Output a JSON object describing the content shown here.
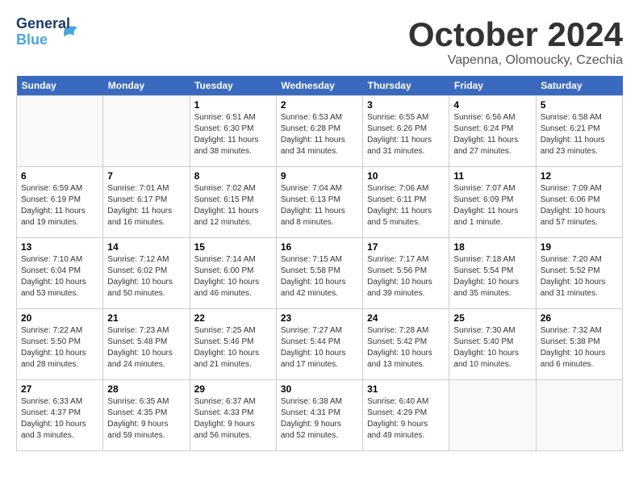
{
  "header": {
    "logo_line1": "General",
    "logo_line2": "Blue",
    "month": "October 2024",
    "location": "Vapenna, Olomoucky, Czechia"
  },
  "days_of_week": [
    "Sunday",
    "Monday",
    "Tuesday",
    "Wednesday",
    "Thursday",
    "Friday",
    "Saturday"
  ],
  "weeks": [
    [
      {
        "day": "",
        "info": ""
      },
      {
        "day": "",
        "info": ""
      },
      {
        "day": "1",
        "info": "Sunrise: 6:51 AM\nSunset: 6:30 PM\nDaylight: 11 hours\nand 38 minutes."
      },
      {
        "day": "2",
        "info": "Sunrise: 6:53 AM\nSunset: 6:28 PM\nDaylight: 11 hours\nand 34 minutes."
      },
      {
        "day": "3",
        "info": "Sunrise: 6:55 AM\nSunset: 6:26 PM\nDaylight: 11 hours\nand 31 minutes."
      },
      {
        "day": "4",
        "info": "Sunrise: 6:56 AM\nSunset: 6:24 PM\nDaylight: 11 hours\nand 27 minutes."
      },
      {
        "day": "5",
        "info": "Sunrise: 6:58 AM\nSunset: 6:21 PM\nDaylight: 11 hours\nand 23 minutes."
      }
    ],
    [
      {
        "day": "6",
        "info": "Sunrise: 6:59 AM\nSunset: 6:19 PM\nDaylight: 11 hours\nand 19 minutes."
      },
      {
        "day": "7",
        "info": "Sunrise: 7:01 AM\nSunset: 6:17 PM\nDaylight: 11 hours\nand 16 minutes."
      },
      {
        "day": "8",
        "info": "Sunrise: 7:02 AM\nSunset: 6:15 PM\nDaylight: 11 hours\nand 12 minutes."
      },
      {
        "day": "9",
        "info": "Sunrise: 7:04 AM\nSunset: 6:13 PM\nDaylight: 11 hours\nand 8 minutes."
      },
      {
        "day": "10",
        "info": "Sunrise: 7:06 AM\nSunset: 6:11 PM\nDaylight: 11 hours\nand 5 minutes."
      },
      {
        "day": "11",
        "info": "Sunrise: 7:07 AM\nSunset: 6:09 PM\nDaylight: 11 hours\nand 1 minute."
      },
      {
        "day": "12",
        "info": "Sunrise: 7:09 AM\nSunset: 6:06 PM\nDaylight: 10 hours\nand 57 minutes."
      }
    ],
    [
      {
        "day": "13",
        "info": "Sunrise: 7:10 AM\nSunset: 6:04 PM\nDaylight: 10 hours\nand 53 minutes."
      },
      {
        "day": "14",
        "info": "Sunrise: 7:12 AM\nSunset: 6:02 PM\nDaylight: 10 hours\nand 50 minutes."
      },
      {
        "day": "15",
        "info": "Sunrise: 7:14 AM\nSunset: 6:00 PM\nDaylight: 10 hours\nand 46 minutes."
      },
      {
        "day": "16",
        "info": "Sunrise: 7:15 AM\nSunset: 5:58 PM\nDaylight: 10 hours\nand 42 minutes."
      },
      {
        "day": "17",
        "info": "Sunrise: 7:17 AM\nSunset: 5:56 PM\nDaylight: 10 hours\nand 39 minutes."
      },
      {
        "day": "18",
        "info": "Sunrise: 7:18 AM\nSunset: 5:54 PM\nDaylight: 10 hours\nand 35 minutes."
      },
      {
        "day": "19",
        "info": "Sunrise: 7:20 AM\nSunset: 5:52 PM\nDaylight: 10 hours\nand 31 minutes."
      }
    ],
    [
      {
        "day": "20",
        "info": "Sunrise: 7:22 AM\nSunset: 5:50 PM\nDaylight: 10 hours\nand 28 minutes."
      },
      {
        "day": "21",
        "info": "Sunrise: 7:23 AM\nSunset: 5:48 PM\nDaylight: 10 hours\nand 24 minutes."
      },
      {
        "day": "22",
        "info": "Sunrise: 7:25 AM\nSunset: 5:46 PM\nDaylight: 10 hours\nand 21 minutes."
      },
      {
        "day": "23",
        "info": "Sunrise: 7:27 AM\nSunset: 5:44 PM\nDaylight: 10 hours\nand 17 minutes."
      },
      {
        "day": "24",
        "info": "Sunrise: 7:28 AM\nSunset: 5:42 PM\nDaylight: 10 hours\nand 13 minutes."
      },
      {
        "day": "25",
        "info": "Sunrise: 7:30 AM\nSunset: 5:40 PM\nDaylight: 10 hours\nand 10 minutes."
      },
      {
        "day": "26",
        "info": "Sunrise: 7:32 AM\nSunset: 5:38 PM\nDaylight: 10 hours\nand 6 minutes."
      }
    ],
    [
      {
        "day": "27",
        "info": "Sunrise: 6:33 AM\nSunset: 4:37 PM\nDaylight: 10 hours\nand 3 minutes."
      },
      {
        "day": "28",
        "info": "Sunrise: 6:35 AM\nSunset: 4:35 PM\nDaylight: 9 hours\nand 59 minutes."
      },
      {
        "day": "29",
        "info": "Sunrise: 6:37 AM\nSunset: 4:33 PM\nDaylight: 9 hours\nand 56 minutes."
      },
      {
        "day": "30",
        "info": "Sunrise: 6:38 AM\nSunset: 4:31 PM\nDaylight: 9 hours\nand 52 minutes."
      },
      {
        "day": "31",
        "info": "Sunrise: 6:40 AM\nSunset: 4:29 PM\nDaylight: 9 hours\nand 49 minutes."
      },
      {
        "day": "",
        "info": ""
      },
      {
        "day": "",
        "info": ""
      }
    ]
  ]
}
